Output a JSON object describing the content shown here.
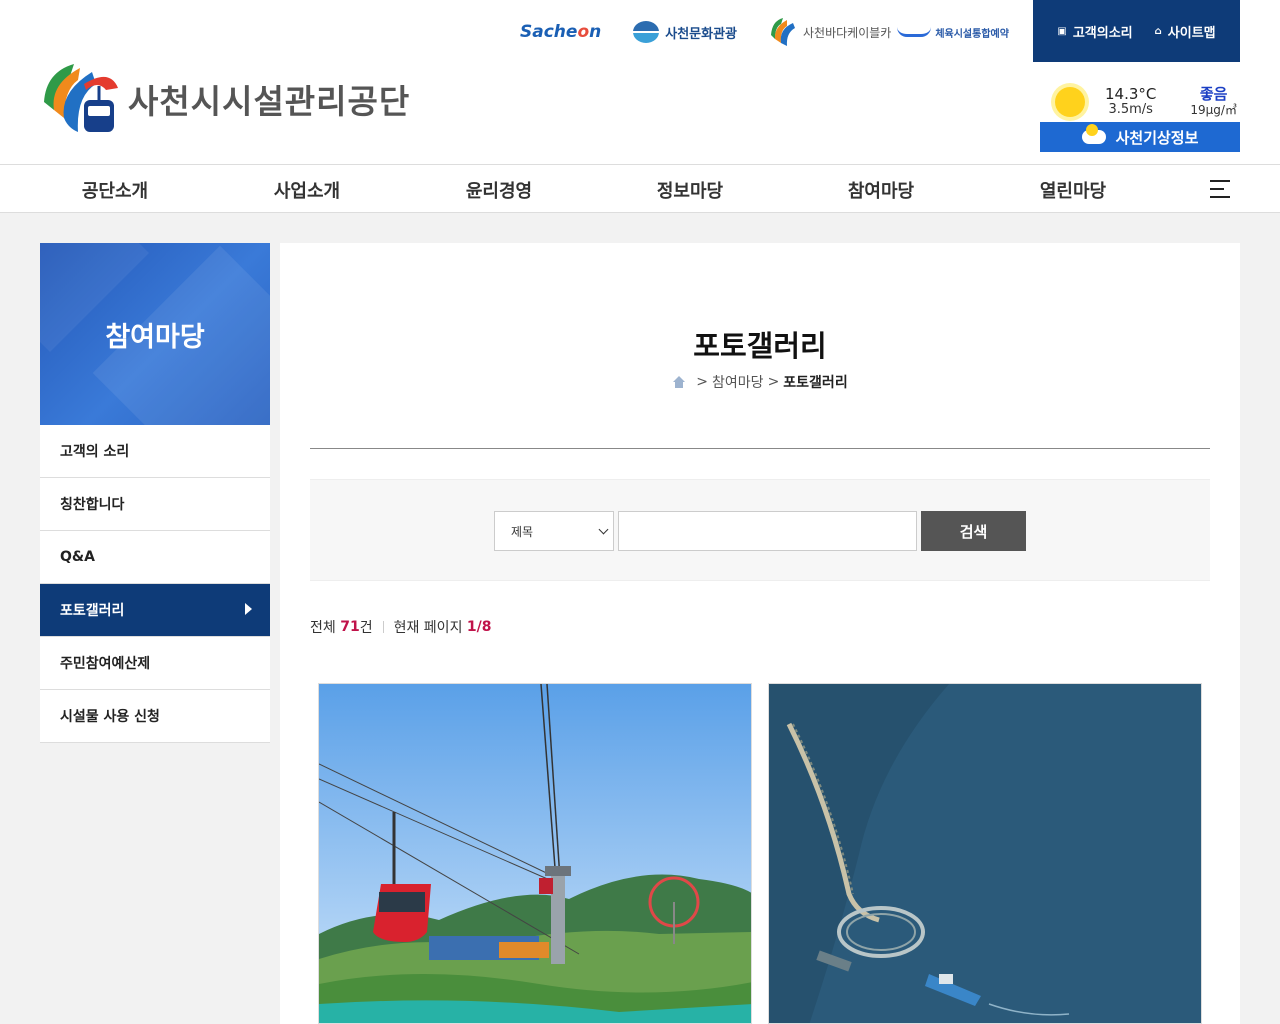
{
  "header": {
    "logo_text": "사천시시설관리공단",
    "family_links": {
      "sachon": {
        "prefix": "Sache",
        "accent": "o",
        "suffix": "n"
      },
      "culture": "사천문화관광",
      "cablecar": "사천바다케이블카",
      "sports": "체육시설통합예약"
    },
    "util": [
      {
        "icon": "document-icon",
        "label": "고객의소리"
      },
      {
        "icon": "home-icon",
        "label": "사이트맵"
      }
    ],
    "weather": {
      "temperature": "14.3°C",
      "wind": "3.5m/s",
      "air_status": "좋음",
      "air_value": "19μg/㎥",
      "button_label": "사천기상정보"
    }
  },
  "gnb": [
    "공단소개",
    "사업소개",
    "윤리경영",
    "정보마당",
    "참여마당",
    "열린마당"
  ],
  "sidebar": {
    "title": "참여마당",
    "items": [
      {
        "label": "고객의 소리",
        "active": false
      },
      {
        "label": "칭찬합니다",
        "active": false
      },
      {
        "label": "Q&A",
        "active": false
      },
      {
        "label": "포토갤러리",
        "active": true
      },
      {
        "label": "주민참여예산제",
        "active": false
      },
      {
        "label": "시설물 사용 신청",
        "active": false
      }
    ]
  },
  "content": {
    "title": "포토갤러리",
    "breadcrumb": {
      "parent": "참여마당",
      "current": "포토갤러리",
      "separator": ">"
    },
    "search": {
      "select_value": "제목",
      "keyword_value": "",
      "button_label": "검색"
    },
    "count": {
      "total_label": "전체",
      "total_value": "71",
      "total_unit": "건",
      "page_label": "현재 페이지",
      "page_value": "1/8"
    }
  },
  "colors": {
    "navy": "#0e3b78",
    "blue": "#1e69d2",
    "accent_red": "#c0134a"
  }
}
